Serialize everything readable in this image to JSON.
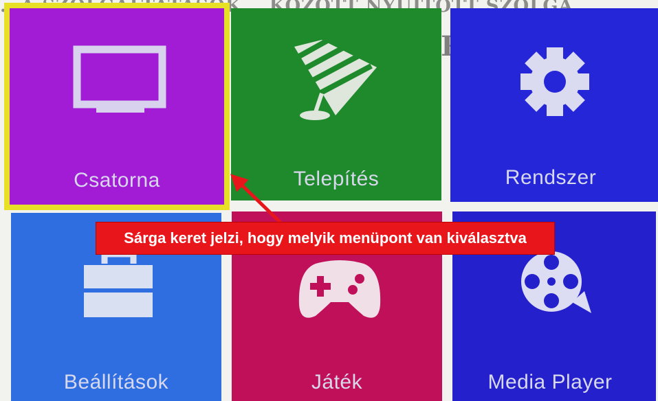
{
  "background": {
    "heading_text": "...A SZOLGÁLTATÁSOK... KÖZÖTT NYÚJTOTT SZOLGÁ",
    "letter_r": "R"
  },
  "menu": {
    "selected_index": 0,
    "colors": {
      "channel": "#a21cd6",
      "install": "#1f8a2c",
      "system": "#2426d8",
      "settings": "#2f6ee0",
      "game": "#c0105a",
      "media": "#2420cc",
      "selection_frame": "#e8e026"
    },
    "tiles": [
      {
        "id": "channel",
        "label": "Csatorna",
        "icon": "tv-icon"
      },
      {
        "id": "install",
        "label": "Telepítés",
        "icon": "satellite-dish-icon"
      },
      {
        "id": "system",
        "label": "Rendszer",
        "icon": "gear-icon"
      },
      {
        "id": "settings",
        "label": "Beállítások",
        "icon": "toolbox-icon"
      },
      {
        "id": "game",
        "label": "Játék",
        "icon": "gamepad-icon"
      },
      {
        "id": "media",
        "label": "Media Player",
        "icon": "film-reel-icon"
      }
    ]
  },
  "annotation": {
    "text": "Sárga keret jelzi, hogy melyik menüpont van kiválasztva",
    "color": "#e8161b"
  }
}
